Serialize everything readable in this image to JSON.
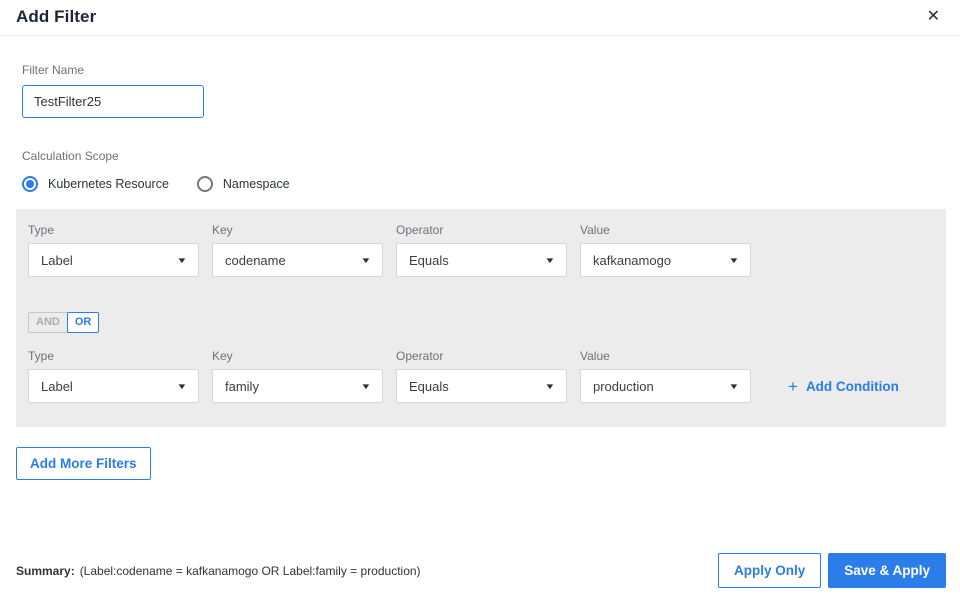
{
  "header": {
    "title": "Add Filter",
    "close_icon": "✕"
  },
  "filter_name": {
    "label": "Filter Name",
    "value": "TestFilter25"
  },
  "calculation_scope": {
    "label": "Calculation Scope",
    "options": [
      {
        "label": "Kubernetes Resource",
        "selected": true
      },
      {
        "label": "Namespace",
        "selected": false
      }
    ]
  },
  "conditions": {
    "field_labels": {
      "type": "Type",
      "key": "Key",
      "operator": "Operator",
      "value": "Value"
    },
    "rows": [
      {
        "type": "Label",
        "key": "codename",
        "operator": "Equals",
        "value": "kafkanamogo"
      },
      {
        "type": "Label",
        "key": "family",
        "operator": "Equals",
        "value": "production"
      }
    ],
    "logic_toggle": {
      "and_label": "AND",
      "or_label": "OR",
      "selected": "OR"
    },
    "add_condition": {
      "plus_icon": "+",
      "label": "Add Condition"
    },
    "caret_icon": "▼"
  },
  "buttons": {
    "add_more_filters": "Add More Filters",
    "apply_only": "Apply Only",
    "save_and_apply": "Save & Apply"
  },
  "summary": {
    "label": "Summary:",
    "text": "(Label:codename = kafkanamogo OR Label:family = production)"
  },
  "colors": {
    "accent": "#2b7de9",
    "panel_background": "#ececec"
  }
}
